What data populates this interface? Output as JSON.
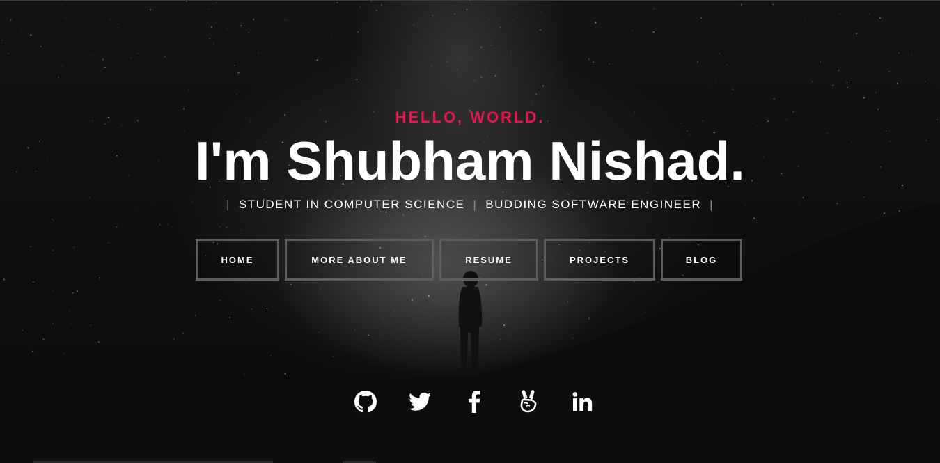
{
  "hero": {
    "greeting": "HELLO, WORLD.",
    "name": "I'm Shubham Nishad.",
    "roles": [
      "STUDENT IN COMPUTER SCIENCE",
      "BUDDING SOFTWARE ENGINEER"
    ],
    "separator": "|"
  },
  "nav": {
    "items": [
      {
        "label": "HOME"
      },
      {
        "label": "MORE ABOUT ME"
      },
      {
        "label": "RESUME"
      },
      {
        "label": "PROJECTS"
      },
      {
        "label": "BLOG"
      }
    ]
  },
  "socials": [
    "github-icon",
    "twitter-icon",
    "facebook-icon",
    "angellist-icon",
    "linkedin-icon"
  ],
  "colors": {
    "accent": "#e8144c",
    "text": "#ffffff",
    "button_border": "#5d5d5d",
    "background": "#0d0c0c"
  }
}
